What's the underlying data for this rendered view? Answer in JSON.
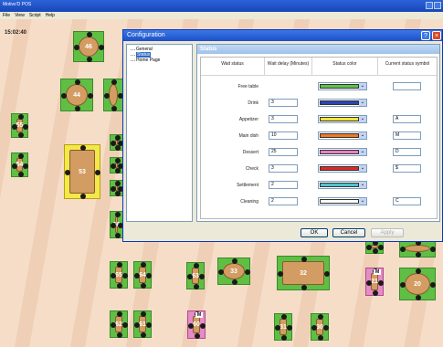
{
  "app": {
    "title": "Motivo'D POS",
    "menu": [
      "File",
      "View",
      "Script",
      "Help"
    ],
    "clock": "15:02:40"
  },
  "floor_tables": [
    {
      "label": "46"
    },
    {
      "label": "44"
    },
    {
      "label": "55"
    },
    {
      "label": "54"
    },
    {
      "label": "53"
    },
    {
      "label": "65"
    },
    {
      "label": "64"
    },
    {
      "label": "63"
    },
    {
      "label": "33"
    },
    {
      "label": "32"
    },
    {
      "label": "21"
    },
    {
      "label": "20"
    },
    {
      "label": "62"
    },
    {
      "label": "61"
    },
    {
      "label": "60"
    },
    {
      "label": "31"
    },
    {
      "label": "30"
    },
    {
      "label": "66"
    }
  ],
  "badges": {
    "b21": "M",
    "b60": "M"
  },
  "config": {
    "title": "Configuration",
    "tree": [
      "General",
      "Status",
      "Home Page"
    ],
    "selected": "Status",
    "panel_title": "Status",
    "headers": {
      "wait_status": "Wait status",
      "wait_delay": "Wait delay (Minutes)",
      "status_color": "Status color",
      "current_symbol": "Current status symbol"
    },
    "rows": [
      {
        "label": "Free table",
        "delay": "",
        "color": "#5ec24a",
        "symbol": ""
      },
      {
        "label": "Drink",
        "delay": "3",
        "color": "#2b43b8",
        "symbol": ""
      },
      {
        "label": "Appetizer",
        "delay": "3",
        "color": "#f0e63a",
        "symbol": "A"
      },
      {
        "label": "Main dish",
        "delay": "10",
        "color": "#f07a22",
        "symbol": "M"
      },
      {
        "label": "Dessert",
        "delay": "25",
        "color": "#ea7fc2",
        "symbol": "D"
      },
      {
        "label": "Check",
        "delay": "3",
        "color": "#e02828",
        "symbol": "$"
      },
      {
        "label": "Settlement",
        "delay": "2",
        "color": "#4bc6d2",
        "symbol": ""
      },
      {
        "label": "Cleaning",
        "delay": "2",
        "color": "#ffffff",
        "symbol": "C"
      }
    ],
    "buttons": {
      "ok": "OK",
      "cancel": "Cancel",
      "apply": "Apply"
    }
  }
}
